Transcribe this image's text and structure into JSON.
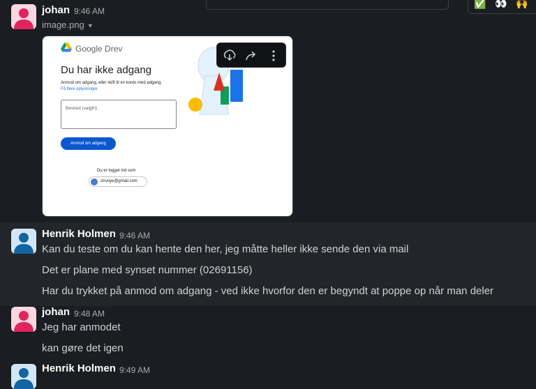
{
  "messages": [
    {
      "author": "johan",
      "time": "9:46 AM"
    },
    {
      "author": "Henrik Holmen",
      "time": "9:46 AM",
      "lines": [
        "Kan du teste om du kan hente den her, jeg måtte heller ikke sende den via mail",
        "Det er plane med synset nummer (02691156)",
        "Har du trykket på anmod om adgang - ved ikke hvorfor den er begyndt at poppe op når man deler"
      ]
    },
    {
      "author": "johan",
      "time": "9:48 AM",
      "lines": [
        "Jeg har anmodet",
        "kan gøre det igen"
      ]
    },
    {
      "author": "Henrik Holmen",
      "time": "9:49 AM"
    }
  ],
  "attachment": {
    "filename": "image.png",
    "caret": "▾",
    "preview": {
      "brand": "Google Drev",
      "title": "Du har ikke adgang",
      "subtitle": "Anmod om adgang, eller skift til en konto med adgang.",
      "link": "Få flere oplysninger",
      "message_placeholder": "Besked (valgfri)",
      "request_button": "Anmod om adgang",
      "logged_in_label": "Du er logget ind som",
      "account_email": "ziruoye@gmail.com"
    }
  },
  "top_reactions": [
    "✅",
    "👀",
    "🙌"
  ],
  "colors": {
    "background": "#1a1d21",
    "hover_background": "#222529",
    "avatar_pink": "#e0245e",
    "avatar_blue": "#1264a3",
    "google_button": "#0b57d0"
  },
  "icons": [
    "download-icon",
    "share-icon",
    "more-vertical-icon",
    "user-avatar-icon",
    "google-drive-logo"
  ]
}
